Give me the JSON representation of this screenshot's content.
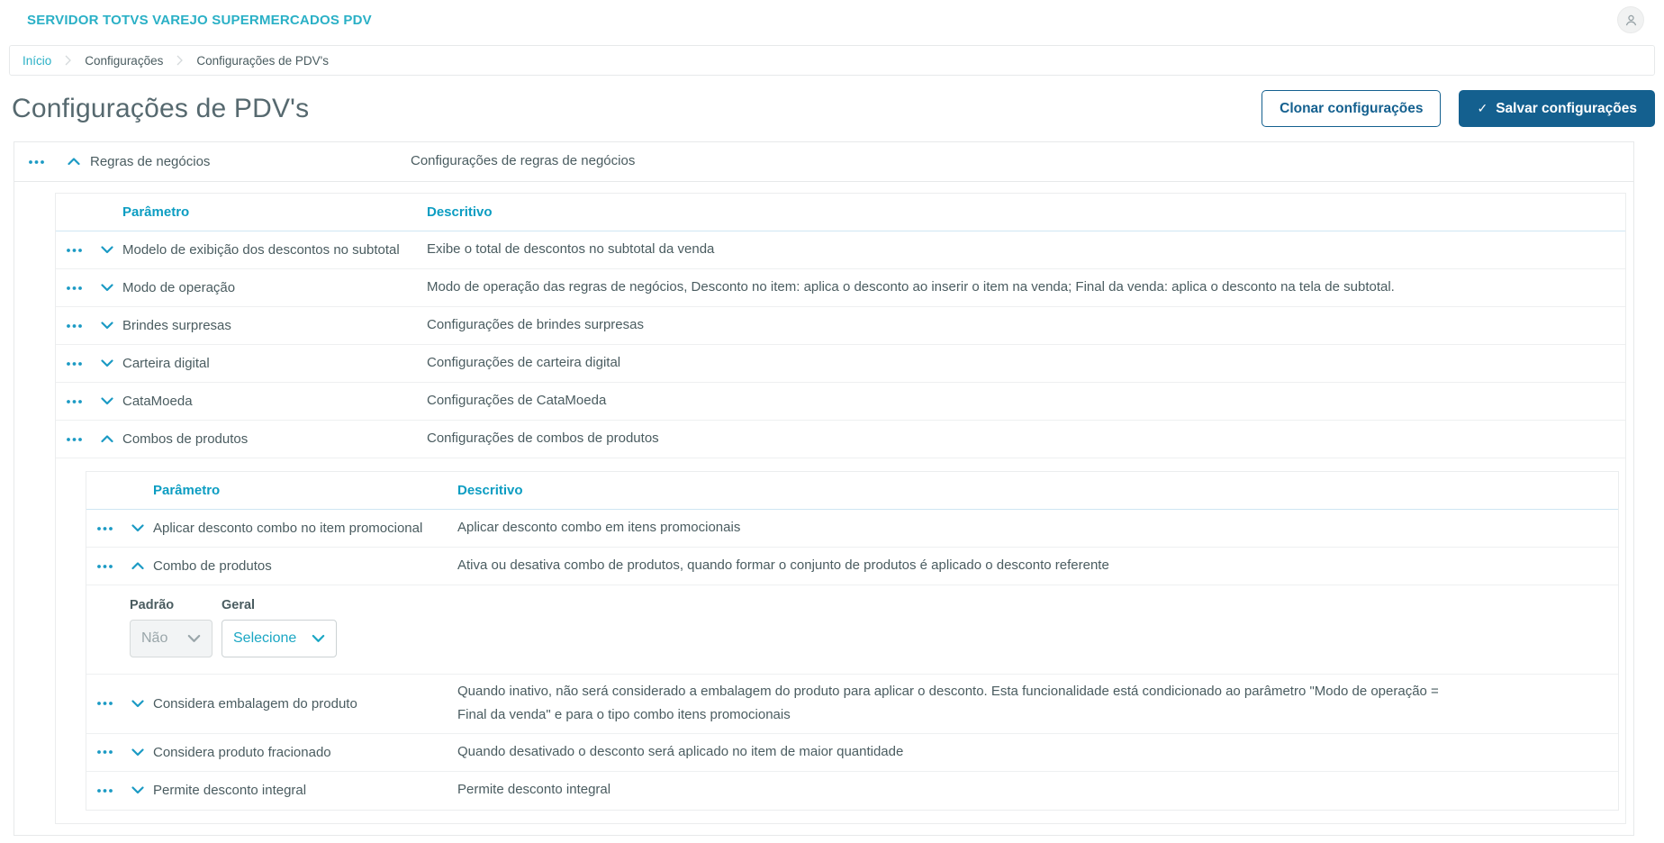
{
  "colors": {
    "accent": "#1ba7c4",
    "primary": "#14608f",
    "header_teal": "#2ab0c6"
  },
  "topbar": {
    "app_title": "SERVIDOR TOTVS VAREJO SUPERMERCADOS PDV"
  },
  "breadcrumb": {
    "items": [
      "Início",
      "Configurações",
      "Configurações de PDV's"
    ]
  },
  "page": {
    "title": "Configurações de PDV's",
    "clone_button_label": "Clonar configurações",
    "save_button_label": "Salvar configurações",
    "save_button_icon": "✓"
  },
  "columns": {
    "param": "Parâmetro",
    "desc": "Descritivo"
  },
  "group": {
    "param": "Regras de negócios",
    "desc": "Configurações de regras de negócios"
  },
  "level1": {
    "rows": [
      {
        "param": "Modelo de exibição dos descontos no subtotal",
        "desc": "Exibe o total de descontos no subtotal da venda"
      },
      {
        "param": "Modo de operação",
        "desc": "Modo de operação das regras de negócios, Desconto no item: aplica o desconto ao inserir o item na venda; Final da venda: aplica o desconto na tela de subtotal."
      },
      {
        "param": "Brindes surpresas",
        "desc": "Configurações de brindes surpresas"
      },
      {
        "param": "Carteira digital",
        "desc": "Configurações de carteira digital"
      },
      {
        "param": "CataMoeda",
        "desc": "Configurações de CataMoeda"
      },
      {
        "param": "Combos de produtos",
        "desc": "Configurações de combos de produtos"
      }
    ]
  },
  "level2": {
    "rows": [
      {
        "param": "Aplicar desconto combo no item promocional",
        "desc": "Aplicar desconto combo em itens promocionais"
      },
      {
        "param": "Combo de produtos",
        "desc": "Ativa ou desativa combo de produtos, quando formar o conjunto de produtos é aplicado o desconto referente"
      },
      {
        "param": "Considera embalagem do produto",
        "desc": "Quando inativo, não será considerado a embalagem do produto para aplicar o desconto. Esta funcionalidade está condicionado ao parâmetro \"Modo de operação = Final da venda\" e para o tipo combo itens promocionais"
      },
      {
        "param": "Considera produto fracionado",
        "desc": "Quando desativado o desconto será aplicado no item de maior quantidade"
      },
      {
        "param": "Permite desconto integral",
        "desc": "Permite desconto integral"
      }
    ],
    "editor": {
      "padrao_label": "Padrão",
      "padrao_value": "Não",
      "geral_label": "Geral",
      "geral_value": "Selecione"
    }
  }
}
